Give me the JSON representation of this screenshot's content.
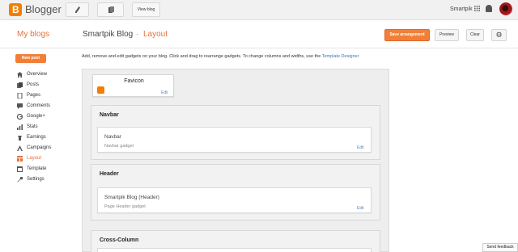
{
  "topbar": {
    "brand": "Blogger",
    "view_blog": "View blog",
    "username": "Smartpik"
  },
  "header": {
    "my_blogs": "My blogs",
    "blog_name": "Smartpik Blog",
    "separator": "·",
    "page": "Layout",
    "save_label": "Save arrangement",
    "preview_label": "Preview",
    "clear_label": "Clear"
  },
  "sidebar": {
    "new_post": "New post",
    "items": [
      {
        "label": "Overview",
        "icon": "home-icon"
      },
      {
        "label": "Posts",
        "icon": "posts-icon"
      },
      {
        "label": "Pages",
        "icon": "pages-icon"
      },
      {
        "label": "Comments",
        "icon": "comment-icon"
      },
      {
        "label": "Google+",
        "icon": "googleplus-icon"
      },
      {
        "label": "Stats",
        "icon": "stats-icon"
      },
      {
        "label": "Earnings",
        "icon": "earnings-icon"
      },
      {
        "label": "Campaigns",
        "icon": "campaigns-icon"
      },
      {
        "label": "Layout",
        "icon": "layout-icon",
        "active": true
      },
      {
        "label": "Template",
        "icon": "template-icon"
      },
      {
        "label": "Settings",
        "icon": "wrench-icon"
      }
    ]
  },
  "main": {
    "instructions": "Add, remove and edit gadgets on your blog. Click and drag to rearrange gadgets. To change columns and widths, use the",
    "template_link": "Template Designer",
    "favicon": {
      "title": "Favicon",
      "edit": "Edit"
    },
    "sections": [
      {
        "title": "Navbar",
        "gadget_name": "Navbar",
        "gadget_type": "Navbar gadget",
        "edit": "Edit"
      },
      {
        "title": "Header",
        "gadget_name": "Smartpik Blog (Header)",
        "gadget_type": "Page Header gadget",
        "edit": "Edit"
      },
      {
        "title": "Cross-Column"
      }
    ]
  },
  "feedback": "Send feedback",
  "colors": {
    "accent": "#f27f38",
    "link": "#3b73c6",
    "brand": "#f57d00"
  }
}
